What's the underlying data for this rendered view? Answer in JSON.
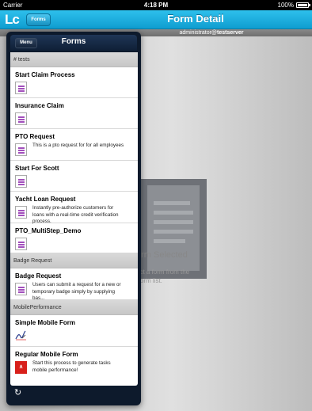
{
  "status_bar": {
    "carrier": "Carrier",
    "time": "4:18 PM",
    "battery": "100%",
    "battery_level": 1.0
  },
  "nav": {
    "logo": "Lc",
    "forms_button": "Forms",
    "title": "Form Detail"
  },
  "subheader": {
    "user": "administrator@",
    "server": "testserver"
  },
  "detail": {
    "empty_title": "No Form Selected",
    "empty_message": "Select a form from the Form list.",
    "visible_title_fragment": "orm Selected",
    "visible_message_line1": "ect a form from the",
    "visible_message_line2": "Form list."
  },
  "popover": {
    "menu_button": "Menu",
    "title": "Forms",
    "sections": [
      {
        "header": "# tests",
        "items": [
          {
            "title": "Start Claim Process",
            "icon": "form-icon",
            "desc": ""
          },
          {
            "title": "Insurance Claim",
            "icon": "form-icon",
            "desc": ""
          },
          {
            "title": "PTO Request",
            "icon": "form-icon",
            "desc": "This is a pto request for for all employees"
          },
          {
            "title": "Start For Scott",
            "icon": "form-icon",
            "desc": ""
          },
          {
            "title": "Yacht Loan Request",
            "icon": "form-icon",
            "desc": "Instantly pre-authorize customers for loans with a real-time credit verification process."
          },
          {
            "title": "PTO_MultiStep_Demo",
            "icon": "form-icon",
            "desc": ""
          }
        ]
      },
      {
        "header": "Badge Request",
        "items": [
          {
            "title": "Badge Request",
            "icon": "form-icon",
            "desc": "Users can submit a request for a new or temporary badge simply by supplying bas..."
          }
        ]
      },
      {
        "header": "MobilePerformance",
        "items": [
          {
            "title": "Simple Mobile Form",
            "icon": "signature-icon",
            "desc": ""
          },
          {
            "title": "Regular Mobile Form",
            "icon": "pdf-icon",
            "desc": "Start this process to generate tasks mobile performance!"
          }
        ]
      }
    ],
    "refresh_icon": "refresh-icon"
  },
  "colors": {
    "nav_blue": "#1aaee0",
    "popover_bg": "#0d1a2c",
    "form_icon_purple": "#a24fbc",
    "pdf_red": "#d8201b"
  }
}
